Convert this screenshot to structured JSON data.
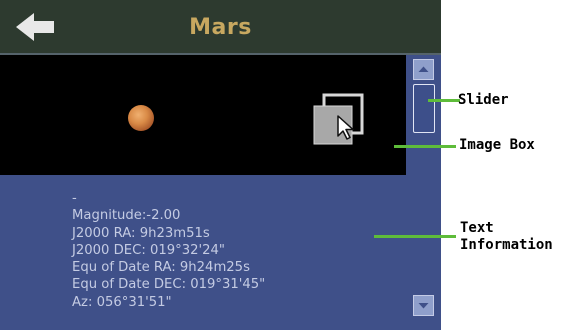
{
  "header": {
    "title": "Mars",
    "back_icon": "back-arrow-icon"
  },
  "image_box": {
    "object": "planet-mars",
    "expand_icon": "expand-view-icon"
  },
  "text_information": {
    "lines": [
      "-",
      "Magnitude:-2.00",
      "J2000 RA: 9h23m51s",
      "J2000 DEC: 019°32'24\"",
      "Equ of Date RA: 9h24m25s",
      "Equ of Date DEC: 019°31'45\"",
      "Az: 056°31'51\""
    ]
  },
  "scrollbar": {
    "up_icon": "scroll-up-icon",
    "down_icon": "scroll-down-icon"
  },
  "annotations": {
    "slider": "Slider",
    "image_box": "Image Box",
    "text_information_line1": "Text",
    "text_information_line2": "Information"
  },
  "colors": {
    "title": "#c8a860",
    "titlebar": "#2d3a2f",
    "panel": "#3f5089",
    "text": "#c4cbe3",
    "callout": "#5ebc3a"
  }
}
